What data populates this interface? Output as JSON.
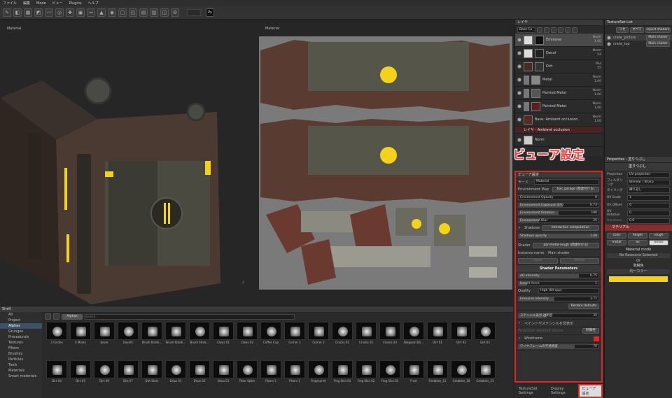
{
  "menu": [
    "ファイル",
    "編集",
    "Mode",
    "ビュー",
    "Plugins",
    "ヘルプ"
  ],
  "toolbar": {
    "ps_label": "Ps"
  },
  "viewport3d": {
    "label": "Material"
  },
  "viewport2d": {
    "label": "Material"
  },
  "layers": {
    "title": "レイヤ",
    "blend_select": "Base Co",
    "items": [
      {
        "name": "Emissive",
        "blend": "Norm",
        "opacity": "1.00"
      },
      {
        "name": "Decal",
        "blend": "Norm",
        "opacity": "54"
      },
      {
        "name": "Dirt",
        "blend": "Mul",
        "opacity": "55"
      },
      {
        "name": "Metal",
        "blend": "Norm",
        "opacity": "1.00"
      },
      {
        "name": "Painted Metal",
        "blend": "Norm",
        "opacity": "1.00"
      },
      {
        "name": "Painted Metal",
        "blend": "Norm",
        "opacity": "1.00"
      },
      {
        "name": "Base: Ambient occlusion",
        "blend": "Norm",
        "opacity": "1.00"
      },
      {
        "name": "レイヤ - Ambient occlusion",
        "blend": "",
        "opacity": ""
      },
      {
        "name": "Norm",
        "blend": "",
        "opacity": ""
      }
    ]
  },
  "texset": {
    "title": "TextureSet List",
    "btn1": "リセ",
    "btn2": "すべて",
    "btn3": "report shaders",
    "items": [
      {
        "name": "crate_pictors",
        "shader": "Main shader"
      },
      {
        "name": "crate_top",
        "shader": "Main shader"
      }
    ]
  },
  "callout": "ビューア設定",
  "viewer": {
    "title": "ビューア設定",
    "mode_label": "モード",
    "mode_value": "Material",
    "env_map_label": "Environment Map",
    "env_map_value": "bus_garage (関連付ける)",
    "env_opacity": "Environment Opacity",
    "env_opacity_val": "0",
    "env_exposure": "Environment Exposure (EV)",
    "env_exposure_val": "0.73",
    "env_rotation": "Environment Rotation",
    "env_rotation_val": "180",
    "env_blur": "Environment Blur",
    "env_blur_val": "25",
    "shadows": "Shadows",
    "shadows_value": "Interactive computation",
    "shadows_opacity": "Shadows opacity",
    "shadows_opacity_val": "1.00",
    "shader_label": "Shader",
    "shader_value": "pbr-metal-rough (関連付ける)",
    "instance_label": "Instance name",
    "instance_value": "Main shader",
    "save": "Save",
    "delete": "Delete",
    "params_header": "Shader Parameters",
    "ao_intensity": "AO intensity",
    "ao_intensity_val": "0.75",
    "height_force": "Height force",
    "height_force_val": "1",
    "quality": "Quality",
    "quality_val": "High (64 spp)",
    "emissive": "Emissive intensity",
    "emissive_val": "3.71",
    "restore": "Restore defaults",
    "stencil": "ステンシル表示 透明度",
    "stencil_val": "35",
    "paint_stencil": "ペイントやステンシルを非表示",
    "projection_label": "Projection element source",
    "projection_val": "制御性",
    "wireframe": "Wireframe",
    "wire_opacity": "ワイヤフレームの不透明度",
    "wire_opacity_val": "70"
  },
  "props": {
    "title": "Properties - 塗りつぶし",
    "fill_header": "塗りつぶし",
    "projection": "Projection",
    "projection_val": "UV projection",
    "filtering": "フィルタリング",
    "filtering_val": "Bilinear | Sharp",
    "tiling": "タイリング",
    "tiling_val": "繰り返し",
    "uv_scale": "UV Scale",
    "uv_scale_val": "1",
    "uv_offset": "UV Offset",
    "uv_offset_val": "0",
    "uv_rotation": "UV Rotation",
    "uv_rotation_val": "0",
    "hardness": "Hardness",
    "hardness_val": "0.0",
    "material_header": "マテリアル",
    "chips": [
      "color",
      "height",
      "rough",
      "metal",
      "ao",
      "emiss"
    ],
    "material_mode": "Material mode",
    "no_resource": "No Resource Selected",
    "or": "Or",
    "uniform": "単純色",
    "tone": "均一カラー"
  },
  "shelf": {
    "title": "Shelf",
    "search_placeholder": "Search...",
    "filter_tag": "Alphas",
    "categories": [
      "All",
      "Project",
      "Alphas",
      "Grunges",
      "Procedurals",
      "Textures",
      "Filters",
      "Brushes",
      "Particles",
      "Tools",
      "Materials",
      "Smart materials"
    ],
    "items": [
      "3 Circles",
      "4 Marks",
      "bevel",
      "bevelX",
      "Brush Rotati...",
      "Brush Rotati...",
      "Brush Strok...",
      "Claws 01",
      "Claws 02",
      "Coffee Cup",
      "Corner 1",
      "Corner 2",
      "Cracks 01",
      "Cracks 02",
      "Cracks 03",
      "Diagonal Dir...",
      "Dirt 01",
      "Dirt 02",
      "Dirt 03",
      "Dirt 04",
      "Dirt 05",
      "Dirt 06",
      "Dirt 07",
      "Dirt Stain",
      "Drips 01",
      "Drips 02",
      "Drips 03",
      "Fiber Spike",
      "Fibers 1",
      "Fibers 1",
      "Fingerprint",
      "Frog Skin 01",
      "Frog Skin 02",
      "Frog Skin 03",
      "Frost",
      "Grebbles_11",
      "Grebbles_18",
      "Grebbles_23"
    ]
  },
  "bottomtabs": [
    "TextureSet Settings",
    "Display Settings",
    "ビューア設定"
  ],
  "colors": {
    "accent": "#e02525",
    "brand_red": "#8a2c2c",
    "yellow": "#f2d21a"
  }
}
